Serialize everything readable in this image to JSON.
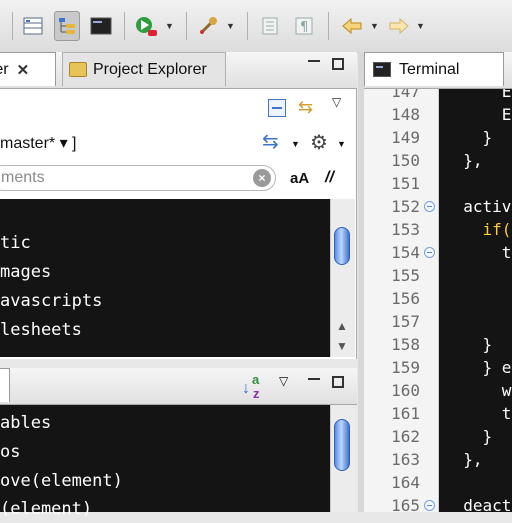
{
  "colors": {
    "accent": "#3e74cf",
    "editor_bg": "#141414",
    "keyword": "#ffcc33",
    "code_text": "#ffffff"
  },
  "toolbar": {
    "icons": [
      "layout-icon",
      "tree-view-icon",
      "tree-view-alt-icon",
      "terminal-icon",
      "run-debug-icon",
      "external-tools-icon",
      "toggle-panel-icon",
      "paragraph-icon",
      "back-arrow-icon",
      "forward-arrow-icon"
    ]
  },
  "left_top": {
    "tabs": [
      {
        "label": "rer"
      },
      {
        "label": "Project Explorer"
      }
    ],
    "branch": "master* ▾ ]",
    "search_placeholder": "ments",
    "case_label": "aA",
    "regex_label": "//",
    "tree_items": [
      "",
      "tic",
      "mages",
      "avascripts",
      "lesheets"
    ]
  },
  "left_bottom": {
    "sort_icon_label": "az",
    "items": [
      "ables",
      "os",
      "ove(element)",
      "(element)"
    ]
  },
  "terminal": {
    "tab_label": "Terminal",
    "lines": [
      {
        "num": "147",
        "code": "      E",
        "fold": false
      },
      {
        "num": "148",
        "code": "      E",
        "fold": false
      },
      {
        "num": "149",
        "code": "    }",
        "fold": false
      },
      {
        "num": "150",
        "code": "  },",
        "fold": false
      },
      {
        "num": "151",
        "code": "",
        "fold": false
      },
      {
        "num": "152",
        "code": "  activ",
        "fold": true
      },
      {
        "num": "153",
        "code": "    if(",
        "fold": false,
        "kw": "if"
      },
      {
        "num": "154",
        "code": "      t",
        "fold": true
      },
      {
        "num": "155",
        "code": "",
        "fold": false
      },
      {
        "num": "156",
        "code": "",
        "fold": false
      },
      {
        "num": "157",
        "code": "",
        "fold": false
      },
      {
        "num": "158",
        "code": "    }",
        "fold": false
      },
      {
        "num": "159",
        "code": "    } e",
        "fold": false
      },
      {
        "num": "160",
        "code": "      w",
        "fold": false
      },
      {
        "num": "161",
        "code": "      t",
        "fold": false
      },
      {
        "num": "162",
        "code": "    }",
        "fold": false
      },
      {
        "num": "163",
        "code": "  },",
        "fold": false
      },
      {
        "num": "164",
        "code": "",
        "fold": false
      },
      {
        "num": "165",
        "code": "  deact",
        "fold": true
      }
    ]
  }
}
